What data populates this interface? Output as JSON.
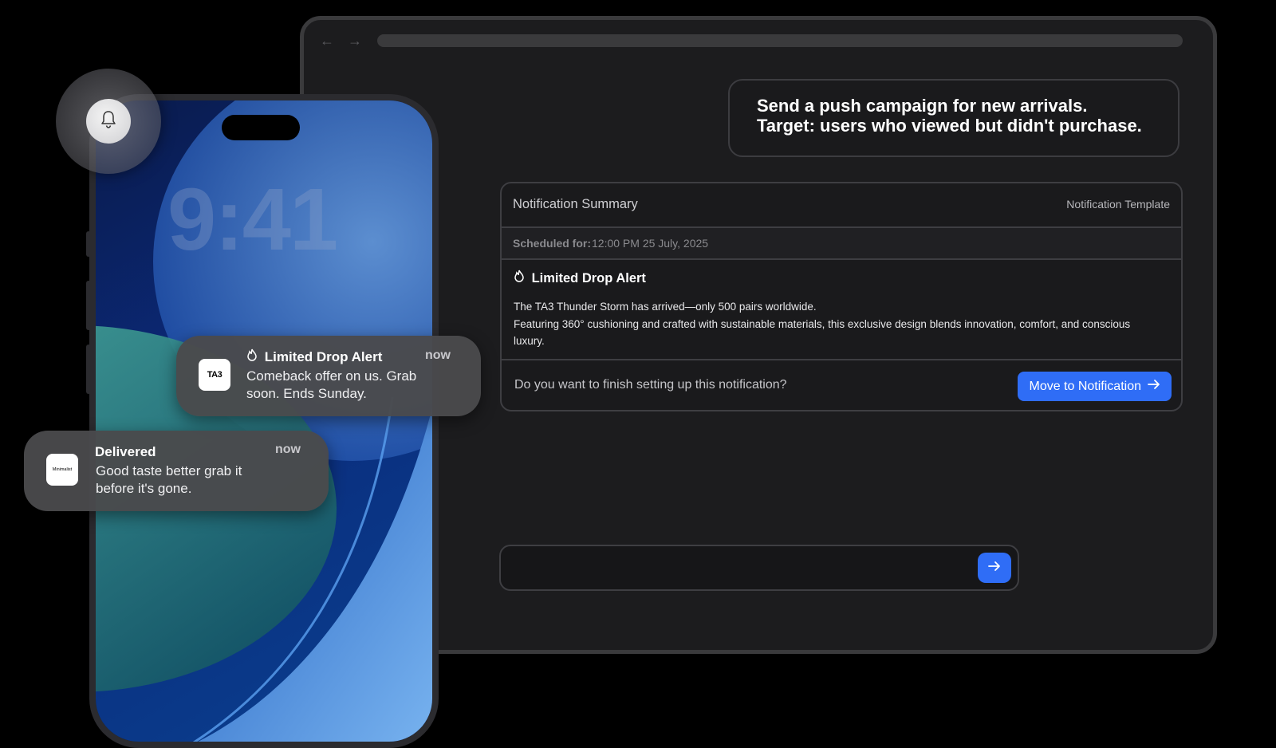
{
  "browser": {
    "nav_arrows": "← →",
    "prompt": {
      "line1": "Send a push campaign for new arrivals.",
      "line2": "Target: users who viewed but didn't purchase."
    },
    "summary": {
      "title": "Notification Summary",
      "template_link": "Notification Template",
      "scheduled_label": "Scheduled for:",
      "scheduled_value": "12:00 PM 25 July, 2025",
      "alert_title": "Limited Drop Alert",
      "desc_line1": "The TA3 Thunder Storm has arrived—only 500 pairs worldwide.",
      "desc_line2": " Featuring 360° cushioning and crafted with sustainable materials, this exclusive design blends innovation, comfort, and conscious luxury.",
      "question": "Do you want to finish setting up this notification?",
      "move_button": "Move to Notification"
    },
    "input": {
      "value": "",
      "placeholder": ""
    }
  },
  "phone": {
    "time": "9:41",
    "notifications": [
      {
        "app_icon_text": "TA3",
        "title": "Limited Drop Alert",
        "time": "now",
        "body_line1": "Comeback offer on us. Grab",
        "body_line2": "soon. Ends Sunday."
      },
      {
        "app_icon_text": "Minimalist",
        "title": "Delivered",
        "time": "now",
        "body_line1": "Good taste better grab it",
        "body_line2": "before it's gone."
      }
    ]
  },
  "icons": {
    "bell": "bell-icon",
    "fire": "fire-icon",
    "arrow_right": "arrow-right-icon"
  },
  "colors": {
    "accent": "#2f6df6",
    "background": "#000000",
    "panel": "#1c1c1e"
  }
}
